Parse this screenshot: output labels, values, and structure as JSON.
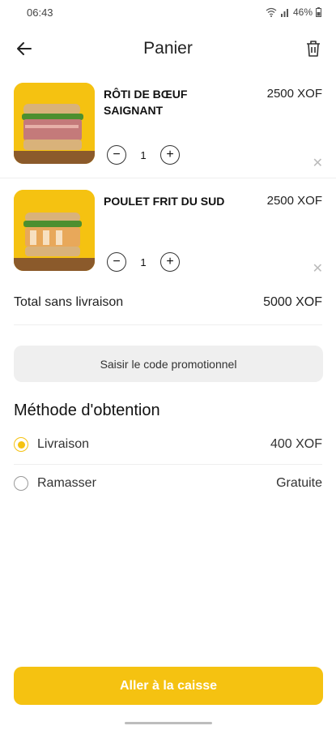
{
  "status_bar": {
    "time": "06:43",
    "battery": "46%"
  },
  "header": {
    "title": "Panier",
    "back_icon": "arrow-left-icon",
    "trash_icon": "trash-icon"
  },
  "cart": {
    "items": [
      {
        "name": "RÔTI DE BŒUF SAIGNANT",
        "price": "2500 XOF",
        "quantity": "1"
      },
      {
        "name": "POULET FRIT DU SUD",
        "price": "2500 XOF",
        "quantity": "1"
      }
    ],
    "minus": "−",
    "plus": "+",
    "remove": "✕"
  },
  "total": {
    "label": "Total sans livraison",
    "value": "5000 XOF"
  },
  "promo": {
    "label": "Saisir le code promotionnel"
  },
  "method": {
    "title": "Méthode d'obtention",
    "options": [
      {
        "label": "Livraison",
        "price": "400 XOF",
        "selected": true
      },
      {
        "label": "Ramasser",
        "price": "Gratuite",
        "selected": false
      }
    ]
  },
  "checkout": {
    "label": "Aller à la caisse"
  },
  "colors": {
    "accent": "#f5c211"
  }
}
